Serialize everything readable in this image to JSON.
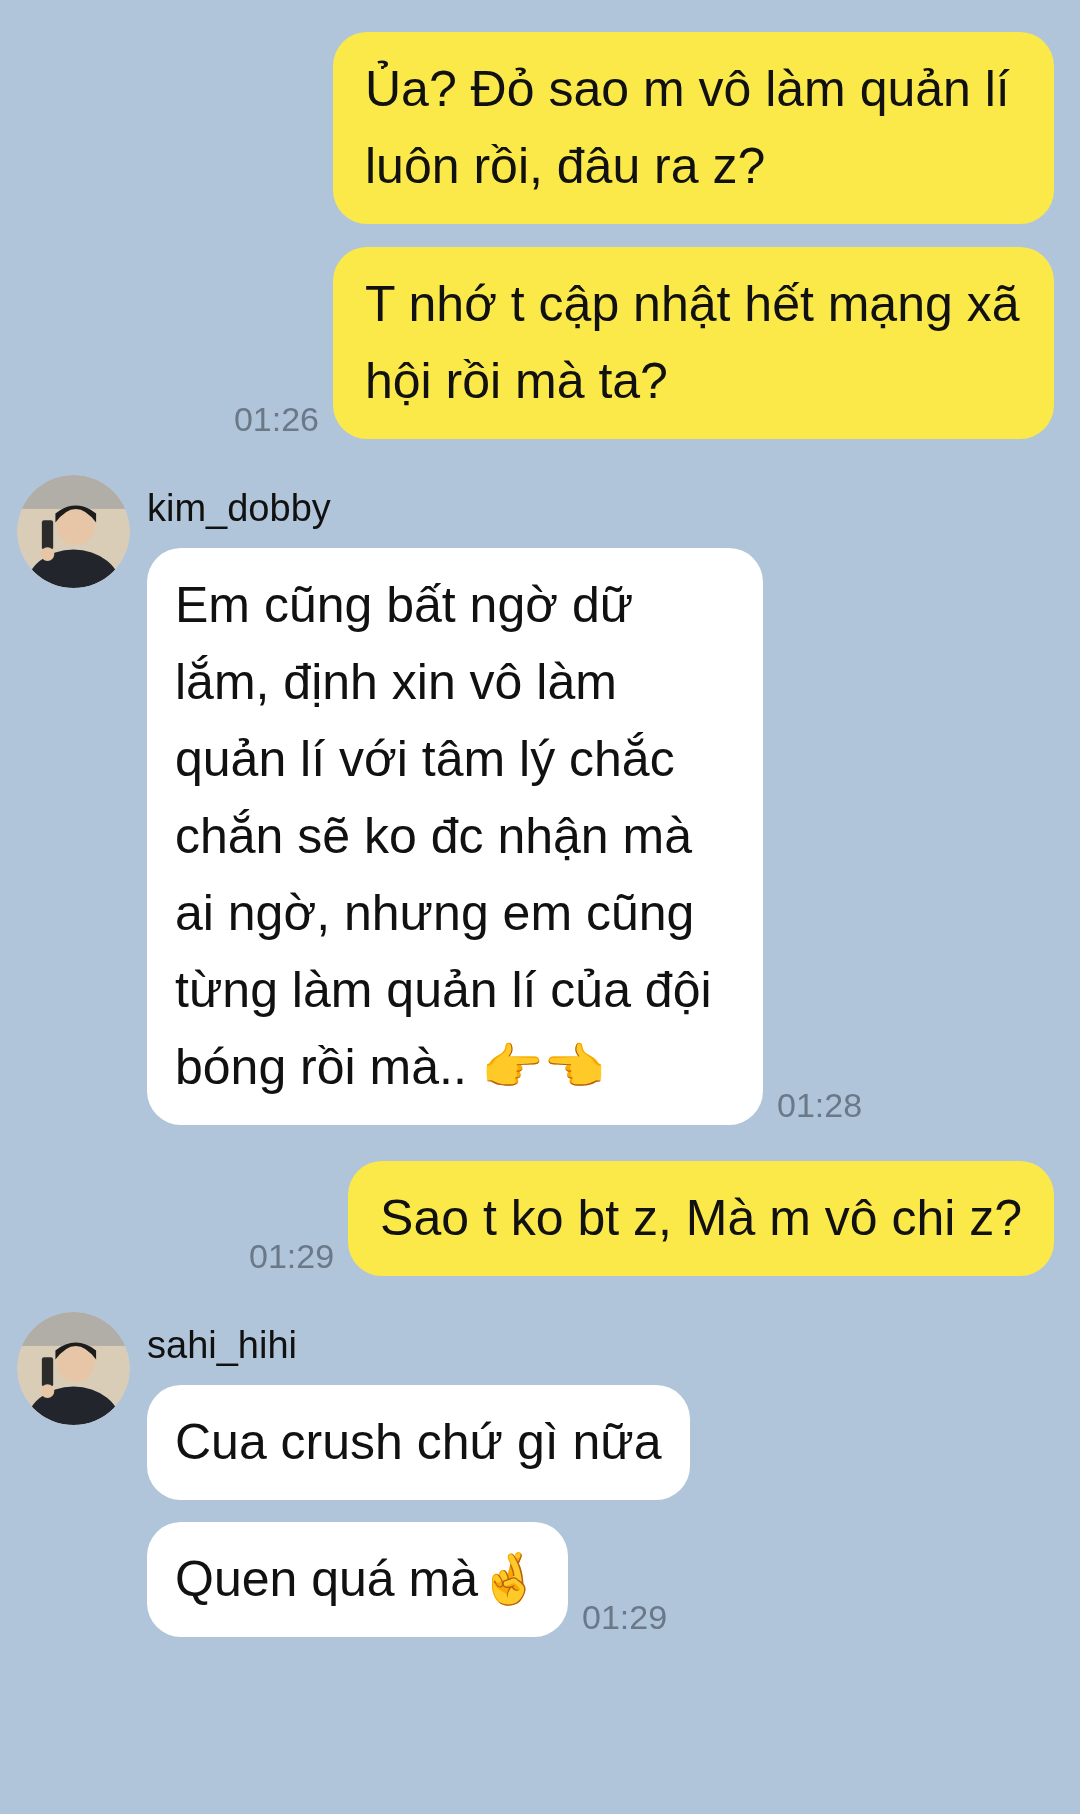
{
  "groups": [
    {
      "kind": "sent",
      "time": "01:26",
      "bubbles": [
        "Ủa? Đỏ sao m vô làm quản lí luôn rồi, đâu ra z?",
        "T nhớ t cập nhật hết mạng xã hội rồi mà ta?"
      ]
    },
    {
      "kind": "received",
      "sender": "kim_dobby",
      "time": "01:28",
      "bubbles": [
        "Em cũng bất ngờ dữ lắm, định xin vô làm quản lí với tâm lý chắc chắn sẽ ko đc nhận mà ai ngờ, nhưng em cũng từng làm quản lí của đội bóng rồi mà.. 👉👈"
      ]
    },
    {
      "kind": "sent",
      "time": "01:29",
      "bubbles": [
        "Sao t ko bt z, Mà m vô chi z?"
      ]
    },
    {
      "kind": "received",
      "sender": "sahi_hihi",
      "time": "01:29",
      "bubbles": [
        "Cua crush chứ gì nữa",
        "Quen quá mà🤞"
      ]
    }
  ]
}
